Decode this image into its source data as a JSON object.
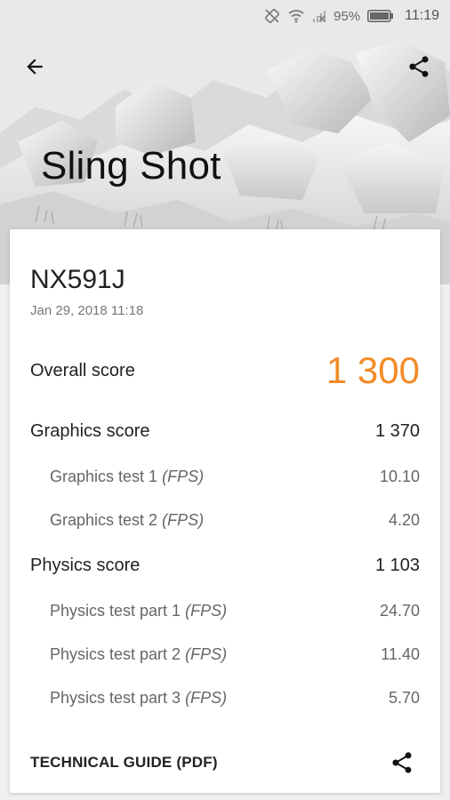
{
  "status_bar": {
    "battery_percent": "95%",
    "time": "11:19",
    "icons": [
      "screen-rotation-off-icon",
      "wifi-icon",
      "signal-off-icon",
      "battery-icon"
    ]
  },
  "app_bar": {
    "back_icon": "arrow-back-icon",
    "share_icon": "share-icon"
  },
  "hero": {
    "title": "Sling Shot"
  },
  "result": {
    "device": "NX591J",
    "date": "Jan 29, 2018 11:18",
    "overall": {
      "label": "Overall score",
      "value": "1 300"
    },
    "graphics": {
      "label": "Graphics score",
      "value": "1 370",
      "tests": [
        {
          "label": "Graphics test 1",
          "unit": "(FPS)",
          "value": "10.10"
        },
        {
          "label": "Graphics test 2",
          "unit": "(FPS)",
          "value": "4.20"
        }
      ]
    },
    "physics": {
      "label": "Physics score",
      "value": "1 103",
      "tests": [
        {
          "label": "Physics test part 1",
          "unit": "(FPS)",
          "value": "24.70"
        },
        {
          "label": "Physics test part 2",
          "unit": "(FPS)",
          "value": "11.40"
        },
        {
          "label": "Physics test part 3",
          "unit": "(FPS)",
          "value": "5.70"
        }
      ]
    }
  },
  "footer": {
    "guide_label": "TECHNICAL GUIDE (PDF)",
    "share_icon": "share-icon"
  },
  "colors": {
    "accent": "#f28c28",
    "text_primary": "#222222",
    "text_secondary": "#666666"
  }
}
